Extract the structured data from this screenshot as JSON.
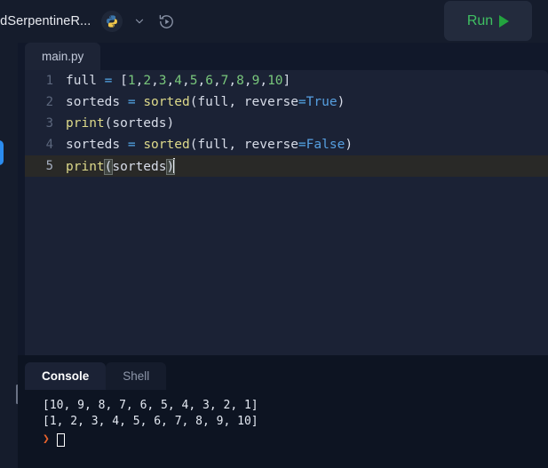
{
  "header": {
    "project_title": "edSerpentineR...",
    "language_icon": "python-icon",
    "dropdown_icon": "chevron-down-icon",
    "history_icon": "history-replay-icon",
    "run_label": "Run",
    "run_icon": "play-triangle-icon",
    "run_color": "#3fbf62"
  },
  "editor": {
    "tab_label": "main.py",
    "active_line": 5,
    "lines": [
      {
        "n": "1",
        "tokens": [
          {
            "t": "full ",
            "c": "plain"
          },
          {
            "t": "=",
            "c": "op"
          },
          {
            "t": " [",
            "c": "plain"
          },
          {
            "t": "1",
            "c": "num"
          },
          {
            "t": ",",
            "c": "plain"
          },
          {
            "t": "2",
            "c": "num"
          },
          {
            "t": ",",
            "c": "plain"
          },
          {
            "t": "3",
            "c": "num"
          },
          {
            "t": ",",
            "c": "plain"
          },
          {
            "t": "4",
            "c": "num"
          },
          {
            "t": ",",
            "c": "plain"
          },
          {
            "t": "5",
            "c": "num"
          },
          {
            "t": ",",
            "c": "plain"
          },
          {
            "t": "6",
            "c": "num"
          },
          {
            "t": ",",
            "c": "plain"
          },
          {
            "t": "7",
            "c": "num"
          },
          {
            "t": ",",
            "c": "plain"
          },
          {
            "t": "8",
            "c": "num"
          },
          {
            "t": ",",
            "c": "plain"
          },
          {
            "t": "9",
            "c": "num"
          },
          {
            "t": ",",
            "c": "plain"
          },
          {
            "t": "10",
            "c": "num"
          },
          {
            "t": "]",
            "c": "plain"
          }
        ]
      },
      {
        "n": "2",
        "tokens": [
          {
            "t": "sorteds ",
            "c": "plain"
          },
          {
            "t": "=",
            "c": "op"
          },
          {
            "t": " ",
            "c": "plain"
          },
          {
            "t": "sorted",
            "c": "fn"
          },
          {
            "t": "(full, reverse",
            "c": "plain"
          },
          {
            "t": "=",
            "c": "op"
          },
          {
            "t": "True",
            "c": "kw"
          },
          {
            "t": ")",
            "c": "plain"
          }
        ]
      },
      {
        "n": "3",
        "tokens": [
          {
            "t": "print",
            "c": "fn"
          },
          {
            "t": "(sorteds)",
            "c": "plain"
          }
        ]
      },
      {
        "n": "4",
        "tokens": [
          {
            "t": "sorteds ",
            "c": "plain"
          },
          {
            "t": "=",
            "c": "op"
          },
          {
            "t": " ",
            "c": "plain"
          },
          {
            "t": "sorted",
            "c": "fn"
          },
          {
            "t": "(full, reverse",
            "c": "plain"
          },
          {
            "t": "=",
            "c": "op"
          },
          {
            "t": "False",
            "c": "kw"
          },
          {
            "t": ")",
            "c": "plain"
          }
        ]
      },
      {
        "n": "5",
        "tokens": [
          {
            "t": "print",
            "c": "fn"
          },
          {
            "t": "(",
            "c": "bracket"
          },
          {
            "t": "sorteds",
            "c": "plain"
          },
          {
            "t": ")",
            "c": "bracket"
          }
        ]
      }
    ]
  },
  "console": {
    "tabs": [
      {
        "label": "Console",
        "active": true
      },
      {
        "label": "Shell",
        "active": false
      }
    ],
    "output_lines": [
      "[10, 9, 8, 7, 6, 5, 4, 3, 2, 1]",
      "[1, 2, 3, 4, 5, 6, 7, 8, 9, 10]"
    ],
    "prompt_symbol": "❯",
    "cursor_icon": "block-cursor"
  }
}
